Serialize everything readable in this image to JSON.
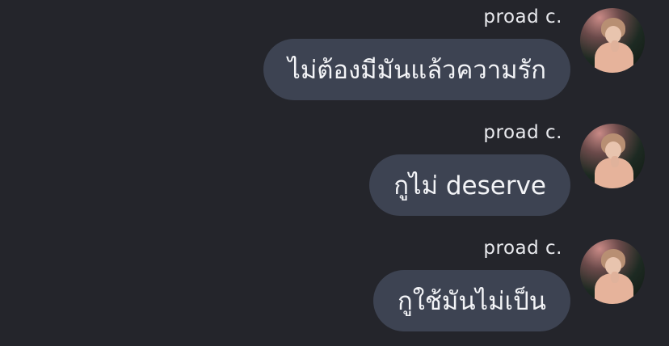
{
  "messages": [
    {
      "sender": "proad c.",
      "text": "ไม่ต้องมีมันแล้วความรัก"
    },
    {
      "sender": "proad c.",
      "text": "กูไม่ deserve"
    },
    {
      "sender": "proad c.",
      "text": "กูใช้มันไม่เป็น"
    }
  ]
}
